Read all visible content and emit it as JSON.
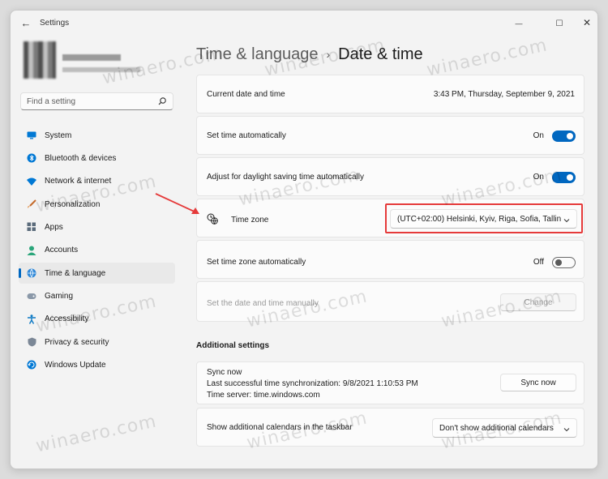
{
  "window": {
    "app_title": "Settings",
    "back_glyph": "←",
    "minimize_glyph": "—",
    "maximize_glyph": "☐",
    "close_glyph": "✕"
  },
  "search": {
    "placeholder": "Find a setting"
  },
  "sidebar": {
    "items": [
      {
        "label": "System",
        "icon": "monitor-icon"
      },
      {
        "label": "Bluetooth & devices",
        "icon": "bluetooth-icon"
      },
      {
        "label": "Network & internet",
        "icon": "wifi-icon"
      },
      {
        "label": "Personalization",
        "icon": "brush-icon"
      },
      {
        "label": "Apps",
        "icon": "apps-icon"
      },
      {
        "label": "Accounts",
        "icon": "person-icon"
      },
      {
        "label": "Time & language",
        "icon": "globe-clock-icon",
        "active": true
      },
      {
        "label": "Gaming",
        "icon": "gamepad-icon"
      },
      {
        "label": "Accessibility",
        "icon": "accessibility-icon"
      },
      {
        "label": "Privacy & security",
        "icon": "shield-icon"
      },
      {
        "label": "Windows Update",
        "icon": "update-icon"
      }
    ]
  },
  "header": {
    "parent": "Time & language",
    "separator": "›",
    "current": "Date & time"
  },
  "cards": {
    "current_datetime": {
      "label": "Current date and time",
      "value": "3:43 PM, Thursday, September 9, 2021"
    },
    "set_time_auto": {
      "label": "Set time automatically",
      "state": "On"
    },
    "dst": {
      "label": "Adjust for daylight saving time automatically",
      "state": "On"
    },
    "time_zone": {
      "label": "Time zone",
      "value": "(UTC+02:00) Helsinki, Kyiv, Riga, Sofia, Tallin"
    },
    "set_tz_auto": {
      "label": "Set time zone automatically",
      "state": "Off"
    },
    "manual": {
      "label": "Set the date and time manually",
      "button": "Change"
    }
  },
  "additional": {
    "heading": "Additional settings",
    "sync": {
      "title": "Sync now",
      "last_sync": "Last successful time synchronization: 9/8/2021 1:10:53 PM",
      "server": "Time server: time.windows.com",
      "button": "Sync now"
    },
    "calendars": {
      "label": "Show additional calendars in the taskbar",
      "value": "Don't show additional calendars"
    }
  },
  "watermark": "winaero.com",
  "colors": {
    "accent": "#0067c0",
    "highlight": "#e53a3a",
    "background": "#f3f3f3",
    "card": "#fbfbfb"
  }
}
